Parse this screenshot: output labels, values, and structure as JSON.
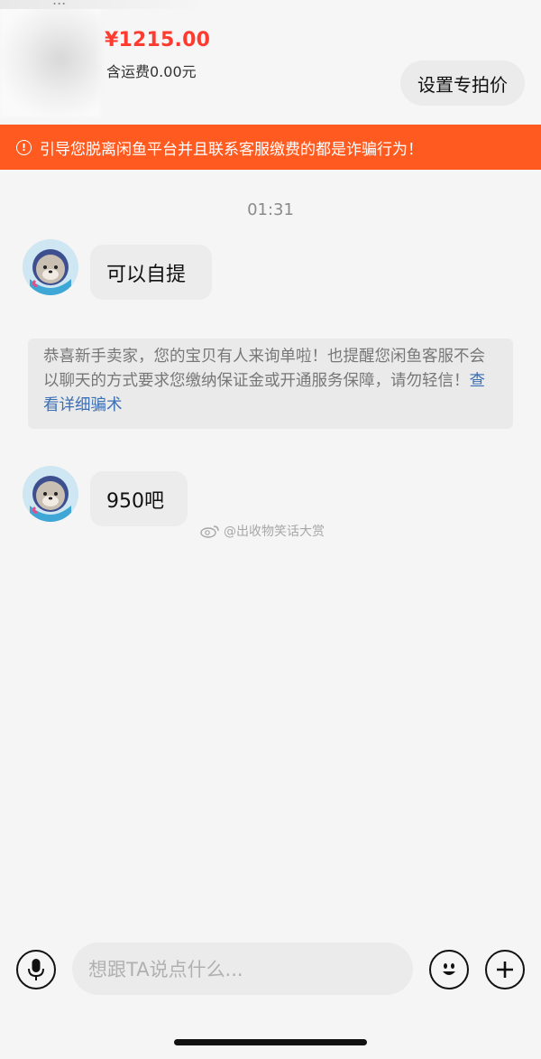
{
  "product": {
    "cut_text": "...",
    "price": "¥1215.00",
    "shipping": "含运费0.00元",
    "set_price_button": "设置专拍价"
  },
  "warning": {
    "icon": "info-circle-icon",
    "text": "引导您脱离闲鱼平台并且联系客服缴费的都是诈骗行为！",
    "color": "#ff5a1f"
  },
  "chat": {
    "timestamp": "01:31",
    "messages": [
      {
        "text": "可以自提"
      },
      {
        "text": "950吧"
      }
    ],
    "notice": {
      "text": "恭喜新手卖家，您的宝贝有人来询单啦！也提醒您闲鱼客服不会以聊天的方式要求您缴纳保证金或开通服务保障，请勿轻信！",
      "link": "查看详细骗术"
    },
    "watermark": "@出收物笑话大赏"
  },
  "input_bar": {
    "placeholder": "想跟TA说点什么..."
  }
}
